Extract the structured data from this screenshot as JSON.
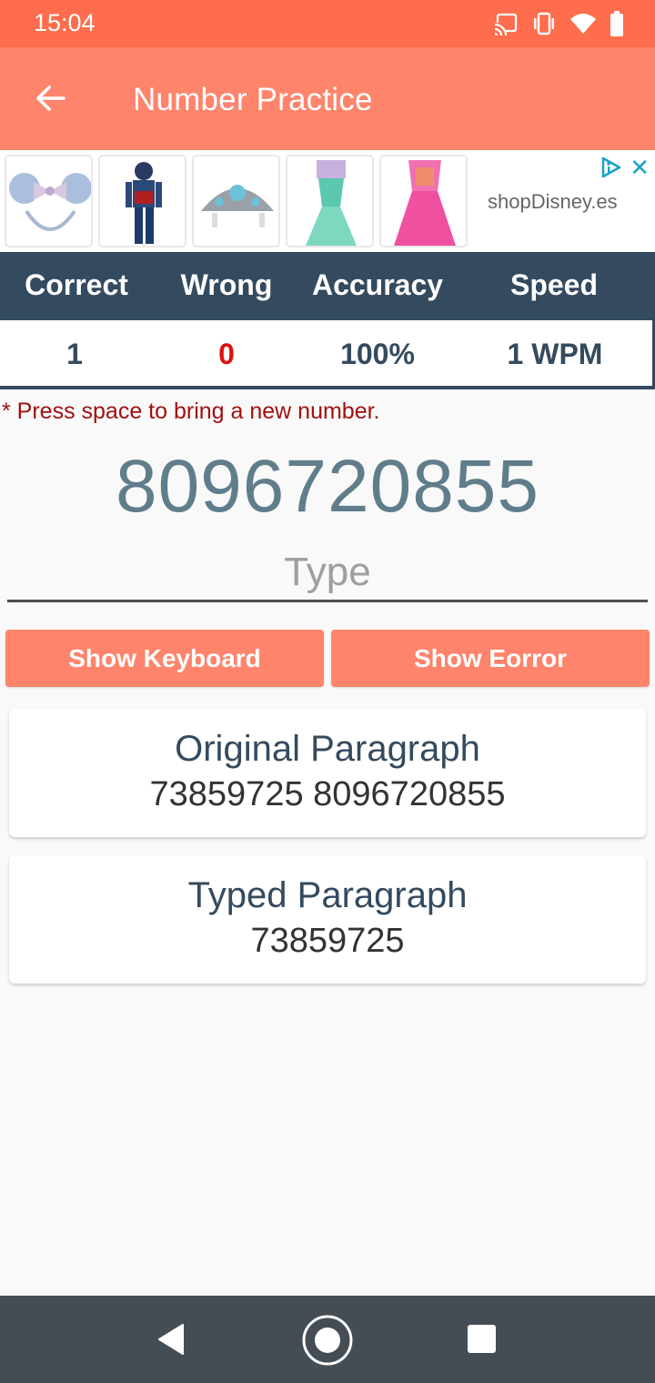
{
  "status_bar": {
    "time": "15:04",
    "icons": [
      "cast-icon",
      "vibrate-icon",
      "wifi-icon",
      "battery-icon"
    ]
  },
  "app_bar": {
    "back_icon": "arrow-left-icon",
    "title": "Number Practice"
  },
  "ad": {
    "products": [
      "minnie-ears-headband",
      "captain-america-costume",
      "princess-tiara",
      "ariel-dress",
      "aurora-dress"
    ],
    "brand": "shopDisney.es",
    "adchoices_icon": "adchoices-icon",
    "close_icon": "close-icon",
    "close_symbol": "✕"
  },
  "stats": {
    "headers": [
      "Correct",
      "Wrong",
      "Accuracy",
      "Speed"
    ],
    "values": {
      "correct": "1",
      "wrong": "0",
      "accuracy": "100%",
      "speed": "1 WPM"
    },
    "colors": {
      "header_bg": "#344a5e",
      "wrong": "#e01010"
    }
  },
  "hint": "* Press space to bring a new number.",
  "practice": {
    "target_number": "8096720855",
    "input_value": "",
    "input_placeholder": "Type"
  },
  "buttons": {
    "show_keyboard": "Show Keyboard",
    "show_error": "Show Eorror"
  },
  "original_paragraph": {
    "title": "Original Paragraph",
    "text": "73859725 8096720855"
  },
  "typed_paragraph": {
    "title": "Typed Paragraph",
    "text": "73859725"
  },
  "theme": {
    "status_bar": "#fe6d4d",
    "accent": "#fe846c",
    "nav_bar": "#454d54"
  },
  "nav": {
    "back": "nav-back-icon",
    "home": "nav-home-icon",
    "recents": "nav-recents-icon"
  }
}
